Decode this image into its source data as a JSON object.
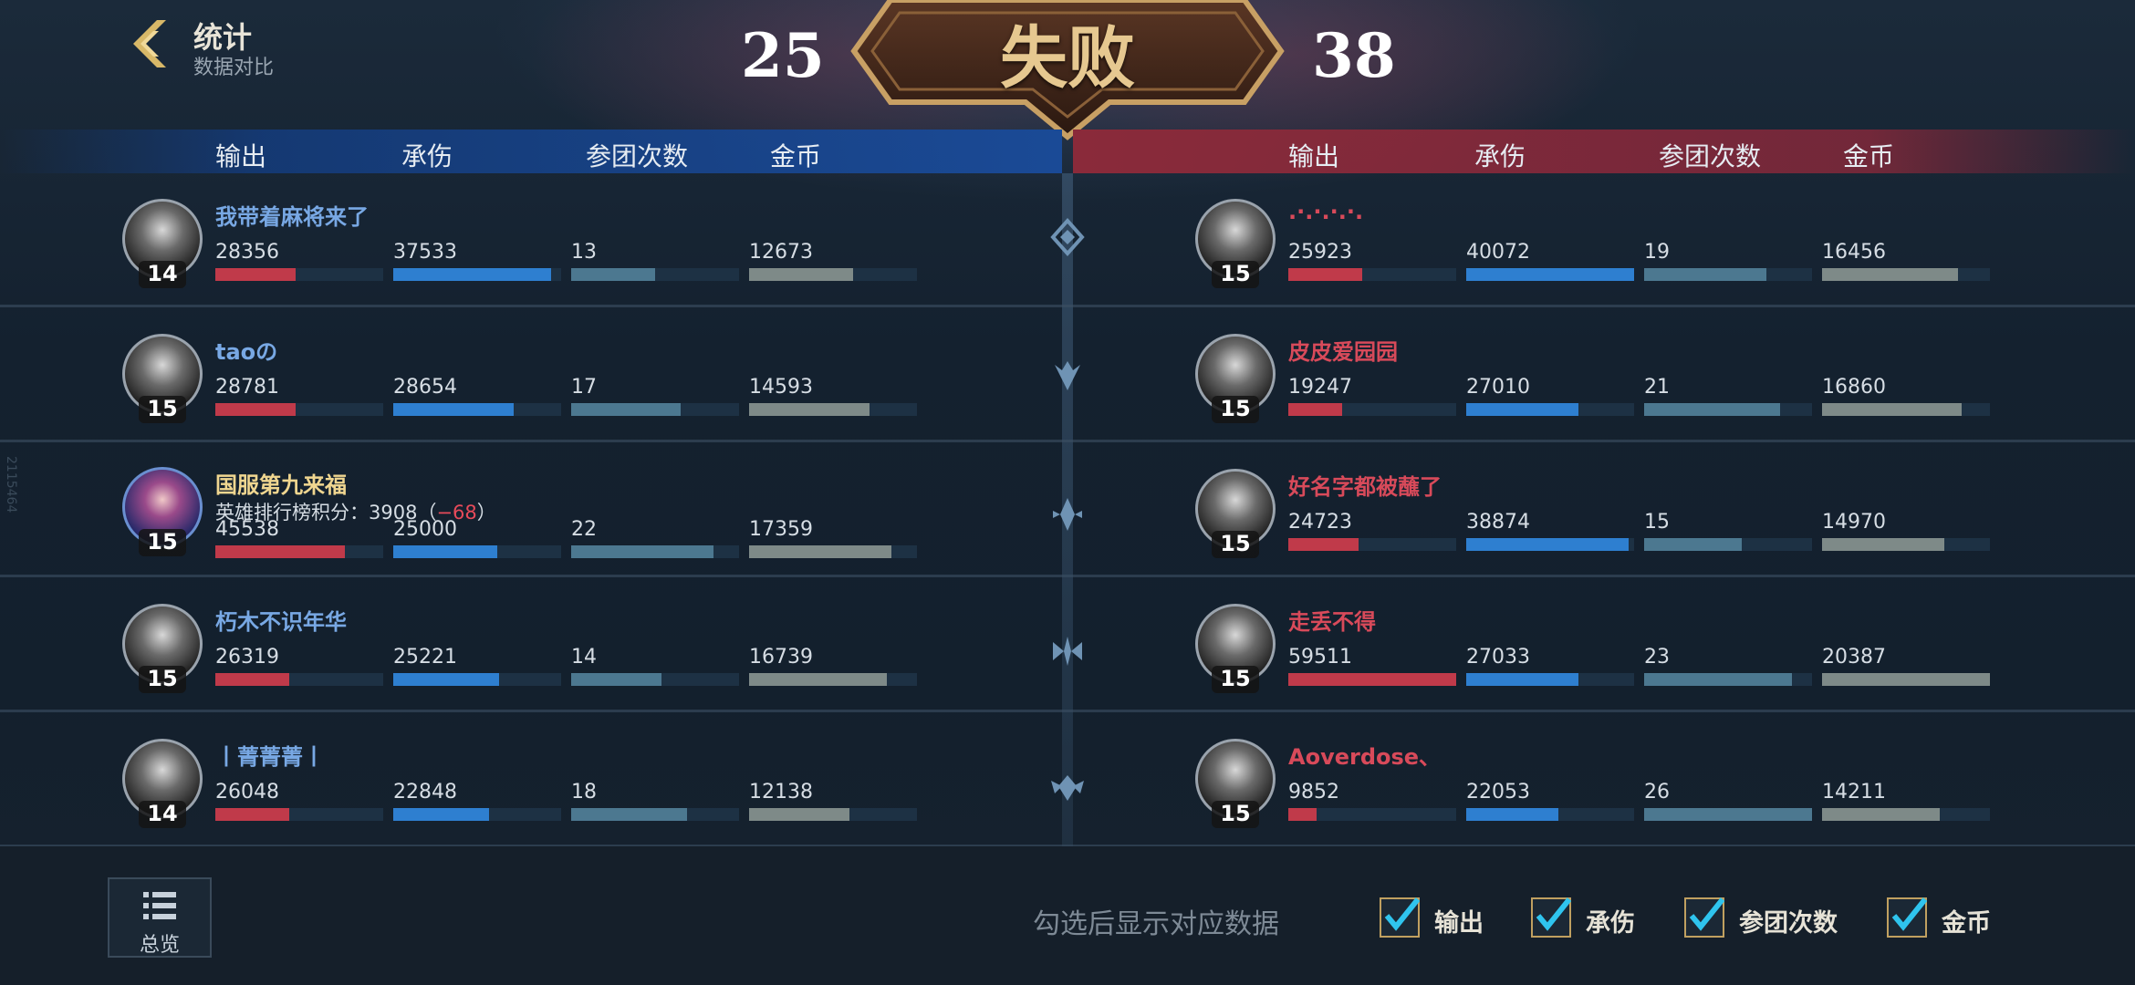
{
  "header": {
    "title": "统计",
    "subtitle": "数据对比",
    "score_left": "25",
    "score_right": "38",
    "result": "失败"
  },
  "columns": {
    "left": [
      "输出",
      "承伤",
      "参团次数",
      "金币"
    ],
    "right": [
      "输出",
      "承伤",
      "参团次数",
      "金币"
    ]
  },
  "side_mark": "2115464",
  "bar_colors": {
    "damage": "#c03a4a",
    "taken": "#2e7fd0",
    "teamfights": "#4c7890",
    "gold": "#7e8a88"
  },
  "left_team": [
    {
      "name": "我带着麻将来了",
      "level": "14",
      "damage": "28356",
      "taken": "37533",
      "teamfights": "13",
      "gold": "12673",
      "fill": {
        "damage": 0.48,
        "taken": 0.94,
        "teamfights": 0.5,
        "gold": 0.62
      }
    },
    {
      "name": "taoの",
      "level": "15",
      "damage": "28781",
      "taken": "28654",
      "teamfights": "17",
      "gold": "14593",
      "fill": {
        "damage": 0.48,
        "taken": 0.72,
        "teamfights": 0.65,
        "gold": 0.72
      }
    },
    {
      "name": "国服第九来福",
      "level": "15",
      "rank_prefix": "英雄排行榜积分：3908（",
      "rank_delta": "−68",
      "rank_suffix": "）",
      "damage": "45538",
      "taken": "25000",
      "teamfights": "22",
      "gold": "17359",
      "fill": {
        "damage": 0.77,
        "taken": 0.62,
        "teamfights": 0.85,
        "gold": 0.85
      }
    },
    {
      "name": "朽木不识年华",
      "level": "15",
      "damage": "26319",
      "taken": "25221",
      "teamfights": "14",
      "gold": "16739",
      "fill": {
        "damage": 0.44,
        "taken": 0.63,
        "teamfights": 0.54,
        "gold": 0.82
      }
    },
    {
      "name": "丨菁菁菁丨",
      "level": "14",
      "damage": "26048",
      "taken": "22848",
      "teamfights": "18",
      "gold": "12138",
      "fill": {
        "damage": 0.44,
        "taken": 0.57,
        "teamfights": 0.69,
        "gold": 0.6
      }
    }
  ],
  "right_team": [
    {
      "name": ".·.·.·.·.",
      "level": "15",
      "damage": "25923",
      "taken": "40072",
      "teamfights": "19",
      "gold": "16456",
      "fill": {
        "damage": 0.44,
        "taken": 1.0,
        "teamfights": 0.73,
        "gold": 0.81
      }
    },
    {
      "name": "皮皮爱园园",
      "level": "15",
      "damage": "19247",
      "taken": "27010",
      "teamfights": "21",
      "gold": "16860",
      "fill": {
        "damage": 0.32,
        "taken": 0.67,
        "teamfights": 0.81,
        "gold": 0.83
      }
    },
    {
      "name": "好名字都被蘸了",
      "level": "15",
      "damage": "24723",
      "taken": "38874",
      "teamfights": "15",
      "gold": "14970",
      "fill": {
        "damage": 0.42,
        "taken": 0.97,
        "teamfights": 0.58,
        "gold": 0.73
      }
    },
    {
      "name": "走丢不得",
      "level": "15",
      "damage": "59511",
      "taken": "27033",
      "teamfights": "23",
      "gold": "20387",
      "fill": {
        "damage": 1.0,
        "taken": 0.67,
        "teamfights": 0.88,
        "gold": 1.0
      }
    },
    {
      "name": "Aoverdose、",
      "level": "15",
      "damage": "9852",
      "taken": "22053",
      "teamfights": "26",
      "gold": "14211",
      "fill": {
        "damage": 0.17,
        "taken": 0.55,
        "teamfights": 1.0,
        "gold": 0.7
      }
    }
  ],
  "footer": {
    "overview_label": "总览",
    "hint": "勾选后显示对应数据",
    "checkboxes": [
      {
        "label": "输出",
        "checked": true
      },
      {
        "label": "承伤",
        "checked": true
      },
      {
        "label": "参团次数",
        "checked": true
      },
      {
        "label": "金币",
        "checked": true
      }
    ]
  }
}
